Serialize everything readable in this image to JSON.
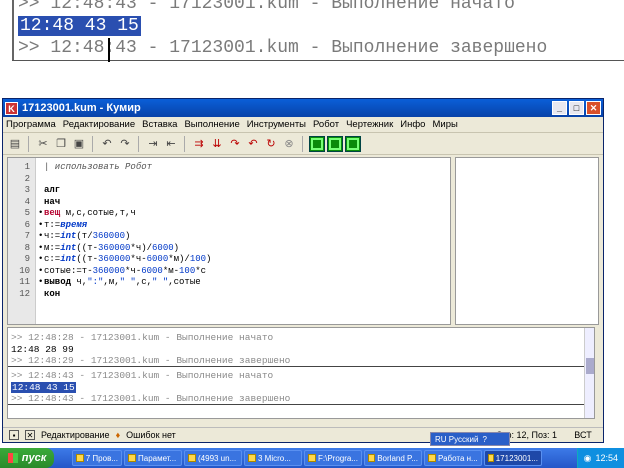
{
  "zoom": {
    "line1": ">> 12:48:43 - 17123001.kum - Выполнение начато",
    "line2": "12:48 43 15",
    "line3": ">> 12:48:43 - 17123001.kum - Выполнение завершено"
  },
  "window": {
    "title": "17123001.kum - Кумир",
    "app_icon": "K",
    "buttons": {
      "minimize": "_",
      "maximize": "□",
      "close": "✕"
    }
  },
  "menu": [
    "Программа",
    "Редактирование",
    "Вставка",
    "Выполнение",
    "Инструменты",
    "Робот",
    "Чертежник",
    "Инфо",
    "Миры"
  ],
  "toolbar_icons": [
    "save-icon",
    "cut-icon",
    "copy-icon",
    "paste-icon",
    "undo-icon",
    "redo-icon",
    "indent-icon",
    "outdent-icon",
    "run-icon",
    "step-icon",
    "step-into-icon",
    "step-out-icon",
    "step-over-icon",
    "stop-icon",
    "robot-window-icon",
    "drawer-window-icon",
    "grid-icon"
  ],
  "editor": {
    "lines": [
      {
        "num": "1",
        "parts": [
          {
            "t": "| использовать Робот",
            "c": "cm"
          }
        ]
      },
      {
        "num": "2",
        "parts": []
      },
      {
        "num": "3",
        "parts": [
          {
            "t": "алг",
            "c": "kw"
          }
        ]
      },
      {
        "num": "4",
        "parts": [
          {
            "t": "нач",
            "c": "kw"
          }
        ]
      },
      {
        "num": "5",
        "parts": [
          {
            "t": "вещ",
            "c": "kw2"
          },
          {
            "t": " м,с,сотые,т,ч",
            "c": ""
          }
        ]
      },
      {
        "num": "6",
        "parts": [
          {
            "t": "т:=",
            "c": ""
          },
          {
            "t": "время",
            "c": "fn"
          }
        ]
      },
      {
        "num": "7",
        "parts": [
          {
            "t": "ч:=",
            "c": ""
          },
          {
            "t": "int",
            "c": "fn"
          },
          {
            "t": "(т/",
            "c": ""
          },
          {
            "t": "360000",
            "c": "num2"
          },
          {
            "t": ")",
            "c": ""
          }
        ]
      },
      {
        "num": "8",
        "parts": [
          {
            "t": "м:=",
            "c": ""
          },
          {
            "t": "int",
            "c": "fn"
          },
          {
            "t": "((т-",
            "c": ""
          },
          {
            "t": "360000",
            "c": "num2"
          },
          {
            "t": "*ч)/",
            "c": ""
          },
          {
            "t": "6000",
            "c": "num2"
          },
          {
            "t": ")",
            "c": ""
          }
        ]
      },
      {
        "num": "9",
        "parts": [
          {
            "t": "с:=",
            "c": ""
          },
          {
            "t": "int",
            "c": "fn"
          },
          {
            "t": "((т-",
            "c": ""
          },
          {
            "t": "360000",
            "c": "num2"
          },
          {
            "t": "*ч-",
            "c": ""
          },
          {
            "t": "6000",
            "c": "num2"
          },
          {
            "t": "*м)/",
            "c": ""
          },
          {
            "t": "100",
            "c": "num2"
          },
          {
            "t": ")",
            "c": ""
          }
        ]
      },
      {
        "num": "10",
        "parts": [
          {
            "t": "сотые:=т-",
            "c": ""
          },
          {
            "t": "360000",
            "c": "num2"
          },
          {
            "t": "*ч-",
            "c": ""
          },
          {
            "t": "6000",
            "c": "num2"
          },
          {
            "t": "*м-",
            "c": ""
          },
          {
            "t": "100",
            "c": "num2"
          },
          {
            "t": "*с",
            "c": ""
          }
        ]
      },
      {
        "num": "11",
        "parts": [
          {
            "t": "вывод",
            "c": "kw"
          },
          {
            "t": " ч,",
            "c": ""
          },
          {
            "t": "\":\"",
            "c": "str"
          },
          {
            "t": ",м,",
            "c": ""
          },
          {
            "t": "\" \"",
            "c": "str"
          },
          {
            "t": ",с,",
            "c": ""
          },
          {
            "t": "\" \"",
            "c": "str"
          },
          {
            "t": ",сотые",
            "c": ""
          }
        ]
      },
      {
        "num": "12",
        "parts": [
          {
            "t": "кон",
            "c": "kw"
          }
        ]
      }
    ],
    "dotted_lines": [
      "5",
      "6",
      "7",
      "8",
      "9",
      "10",
      "11"
    ]
  },
  "output": {
    "lines": [
      {
        "text": ">> 12:48:28 - 17123001.kum - Выполнение начато",
        "style": "grey"
      },
      {
        "text": "12:48 28 99",
        "style": ""
      },
      {
        "text": ">> 12:48:29 - 17123001.kum - Выполнение завершено",
        "style": "grey"
      },
      {
        "text": ">> 12:48:43 - 17123001.kum - Выполнение начато",
        "style": "grey"
      },
      {
        "text": "12:48 43 15",
        "style": "sel"
      },
      {
        "text": ">> 12:48:43 - 17123001.kum - Выполнение завершено",
        "style": "grey"
      }
    ]
  },
  "status": {
    "mode_label": "Редактирование",
    "errors": "Ошибок нет",
    "position": "Стр: 12, Поз: 1",
    "insert_mode": "ВСТ"
  },
  "language_bar": {
    "label": "RU Русский",
    "help": "?"
  },
  "taskbar": {
    "start": "пуск",
    "tasks": [
      {
        "label": "7 Пров...",
        "active": false
      },
      {
        "label": "Парамет...",
        "active": false
      },
      {
        "label": "(4993 un...",
        "active": false
      },
      {
        "label": "3 Micro...",
        "active": false
      },
      {
        "label": "F:\\Progra...",
        "active": false
      },
      {
        "label": "Borland P...",
        "active": false
      },
      {
        "label": "Работа н...",
        "active": false
      },
      {
        "label": "17123001...",
        "active": true
      }
    ],
    "clock": "12:54"
  }
}
